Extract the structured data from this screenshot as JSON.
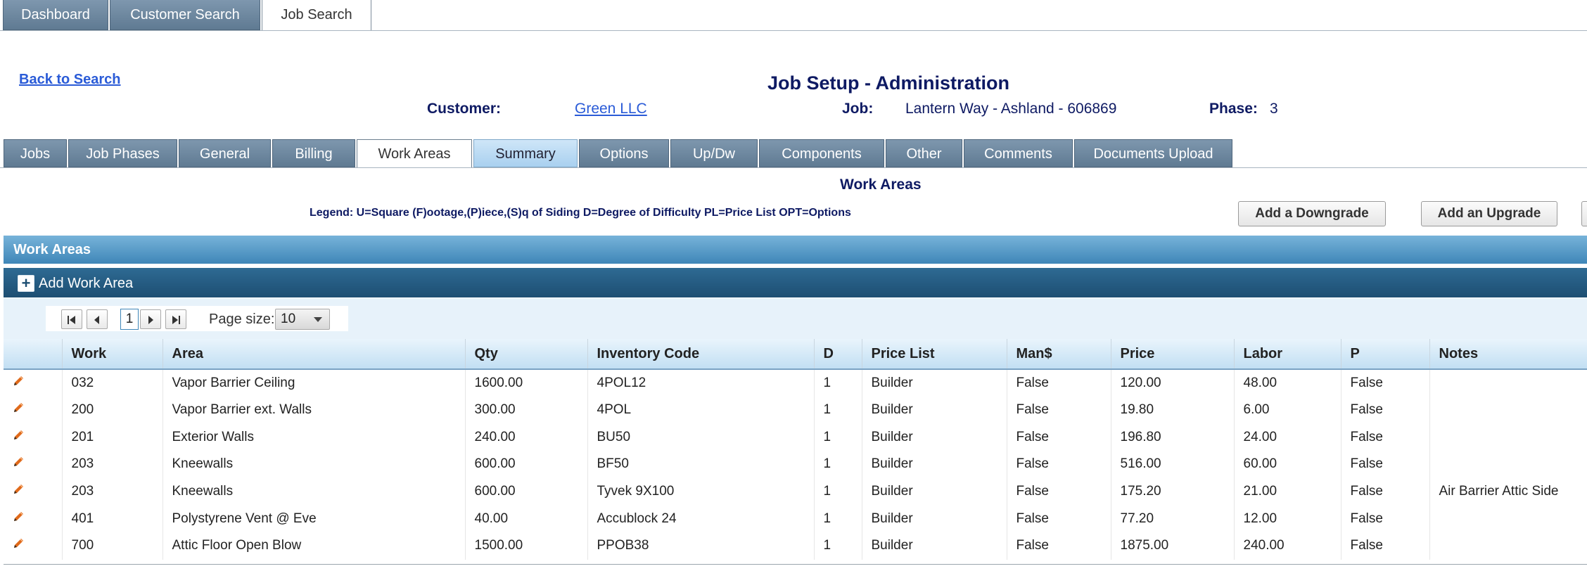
{
  "top_tabs": [
    "Dashboard",
    "Customer Search",
    "Job Search"
  ],
  "back_link": "Back to Search",
  "page_title": "Job Setup - Administration",
  "info": {
    "customer_label": "Customer:",
    "customer_value": "Green LLC",
    "job_label": "Job:",
    "job_value": "Lantern Way - Ashland - 606869",
    "phase_label": "Phase:",
    "phase_value": "3"
  },
  "sub_tabs": [
    "Jobs",
    "Job Phases",
    "General",
    "Billing",
    "Work Areas",
    "Summary",
    "Options",
    "Up/Dw",
    "Components",
    "Other",
    "Comments",
    "Documents Upload"
  ],
  "section_title": "Work Areas",
  "legend": "Legend: U=Square (F)ootage,(P)iece,(S)q of Siding D=Degree of Difficulty PL=Price List OPT=Options",
  "buttons": {
    "downgrade": "Add a Downgrade",
    "upgrade": "Add an Upgrade"
  },
  "panel_title": "Work Areas",
  "add_work_area": "Add Work Area",
  "pager": {
    "page": "1",
    "page_size_label": "Page size:",
    "page_size": "10"
  },
  "columns": [
    "Work",
    "Area",
    "Qty",
    "Inventory Code",
    "D",
    "Price List",
    "Man$",
    "Price",
    "Labor",
    "P",
    "Notes"
  ],
  "rows": [
    {
      "work": "032",
      "area": "Vapor Barrier Ceiling",
      "qty": "1600.00",
      "code": "4POL12",
      "d": "1",
      "price_list": "Builder",
      "man": "False",
      "price": "120.00",
      "labor": "48.00",
      "p": "False",
      "notes": ""
    },
    {
      "work": "200",
      "area": "Vapor Barrier ext. Walls",
      "qty": "300.00",
      "code": "4POL",
      "d": "1",
      "price_list": "Builder",
      "man": "False",
      "price": "19.80",
      "labor": "6.00",
      "p": "False",
      "notes": ""
    },
    {
      "work": "201",
      "area": "Exterior Walls",
      "qty": "240.00",
      "code": "BU50",
      "d": "1",
      "price_list": "Builder",
      "man": "False",
      "price": "196.80",
      "labor": "24.00",
      "p": "False",
      "notes": ""
    },
    {
      "work": "203",
      "area": "Kneewalls",
      "qty": "600.00",
      "code": "BF50",
      "d": "1",
      "price_list": "Builder",
      "man": "False",
      "price": "516.00",
      "labor": "60.00",
      "p": "False",
      "notes": ""
    },
    {
      "work": "203",
      "area": "Kneewalls",
      "qty": "600.00",
      "code": "Tyvek 9X100",
      "d": "1",
      "price_list": "Builder",
      "man": "False",
      "price": "175.20",
      "labor": "21.00",
      "p": "False",
      "notes": "Air Barrier Attic Side"
    },
    {
      "work": "401",
      "area": "Polystyrene Vent @ Eve",
      "qty": "40.00",
      "code": "Accublock 24",
      "d": "1",
      "price_list": "Builder",
      "man": "False",
      "price": "77.20",
      "labor": "12.00",
      "p": "False",
      "notes": ""
    },
    {
      "work": "700",
      "area": "Attic Floor Open Blow",
      "qty": "1500.00",
      "code": "PPOB38",
      "d": "1",
      "price_list": "Builder",
      "man": "False",
      "price": "1875.00",
      "labor": "240.00",
      "p": "False",
      "notes": ""
    }
  ],
  "colors": {
    "tab_bg": "#6d87a0",
    "title_navy": "#0e1a63",
    "link_blue": "#2a5bd7",
    "panel_header": "#4b93c4",
    "toolbar": "#24587f",
    "edit_icon": "#e06a1b"
  }
}
